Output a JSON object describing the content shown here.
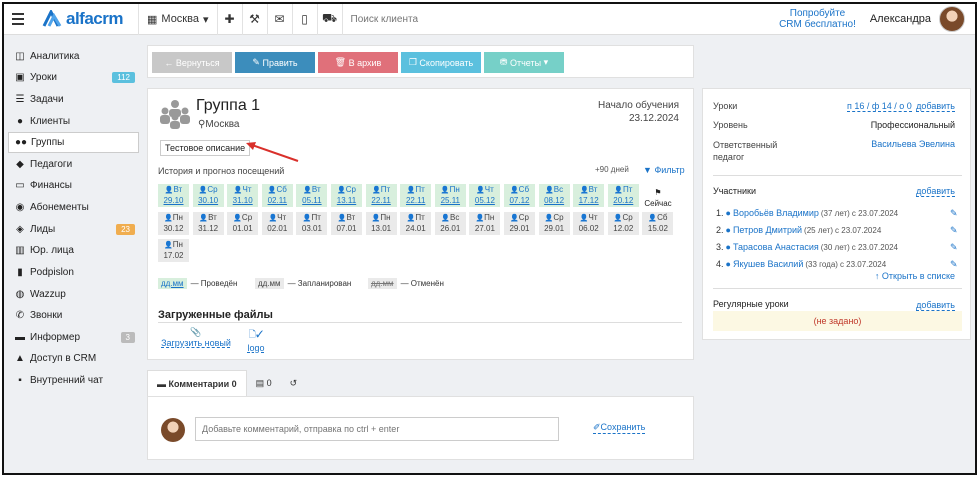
{
  "header": {
    "logo_text": "alfacrm",
    "branch": "Москва",
    "search_placeholder": "Поиск клиента",
    "promo_line1": "Попробуйте",
    "promo_line2": "CRM бесплатно!",
    "user_name": "Александра"
  },
  "sidebar": {
    "items": [
      {
        "label": "Аналитика",
        "icon": "chart-icon"
      },
      {
        "label": "Уроки",
        "icon": "calendar-icon",
        "badge": "112",
        "badge_color": "#5bc0de"
      },
      {
        "label": "Задачи",
        "icon": "tasks-icon"
      },
      {
        "label": "Клиенты",
        "icon": "user-icon"
      },
      {
        "label": "Группы",
        "icon": "group-icon",
        "active": true
      },
      {
        "label": "Педагоги",
        "icon": "graduation-cap-icon"
      },
      {
        "label": "Финансы",
        "icon": "money-icon"
      },
      {
        "label": "Абонементы",
        "icon": "subscription-icon"
      },
      {
        "label": "Лиды",
        "icon": "leads-icon",
        "badge": "23",
        "badge_color": "#f0ad4e"
      },
      {
        "label": "Юр. лица",
        "icon": "building-icon"
      },
      {
        "label": "Podpislon",
        "icon": "document-icon"
      },
      {
        "label": "Wazzup",
        "icon": "whatsapp-icon"
      },
      {
        "label": "Звонки",
        "icon": "phone-icon"
      },
      {
        "label": "Информер",
        "icon": "message-icon",
        "badge": "3",
        "badge_color": "#bbbbbb"
      },
      {
        "label": "Доступ в CRM",
        "icon": "lock-icon"
      },
      {
        "label": "Внутренний чат",
        "icon": "chat-icon"
      }
    ]
  },
  "actions": {
    "back": "← Вернуться",
    "edit": "Править",
    "archive": "В архив",
    "copy": "Скопировать",
    "reports": "Отчеты"
  },
  "group": {
    "title": "Группа 1",
    "city": "Москва",
    "start_label": "Начало обучения",
    "start_date": "23.12.2024",
    "description": "Тестовое описание",
    "history_label": "История и прогноз посещений",
    "days_label": "+90 дней",
    "filter_label": "Фильтр",
    "now_label": "Сейчас"
  },
  "attendance": {
    "done": [
      {
        "wd": "Вт",
        "date": "29.10"
      },
      {
        "wd": "Ср",
        "date": "30.10"
      },
      {
        "wd": "Чт",
        "date": "31.10"
      },
      {
        "wd": "Сб",
        "date": "02.11"
      },
      {
        "wd": "Вт",
        "date": "05.11"
      },
      {
        "wd": "Ср",
        "date": "13.11"
      },
      {
        "wd": "Пт",
        "date": "22.11"
      },
      {
        "wd": "Пт",
        "date": "22.11"
      },
      {
        "wd": "Пн",
        "date": "25.11"
      },
      {
        "wd": "Чт",
        "date": "05.12"
      },
      {
        "wd": "Сб",
        "date": "07.12"
      },
      {
        "wd": "Вс",
        "date": "08.12"
      },
      {
        "wd": "Вт",
        "date": "17.12"
      },
      {
        "wd": "Пт",
        "date": "20.12"
      }
    ],
    "planned": [
      {
        "wd": "Пн",
        "date": "30.12"
      },
      {
        "wd": "Вт",
        "date": "31.12"
      },
      {
        "wd": "Ср",
        "date": "01.01"
      },
      {
        "wd": "Чт",
        "date": "02.01"
      },
      {
        "wd": "Пт",
        "date": "03.01"
      },
      {
        "wd": "Вт",
        "date": "07.01"
      },
      {
        "wd": "Пн",
        "date": "13.01"
      },
      {
        "wd": "Пт",
        "date": "24.01"
      },
      {
        "wd": "Вс",
        "date": "26.01"
      },
      {
        "wd": "Пн",
        "date": "27.01"
      },
      {
        "wd": "Ср",
        "date": "29.01"
      },
      {
        "wd": "Ср",
        "date": "29.01"
      },
      {
        "wd": "Чт",
        "date": "06.02"
      },
      {
        "wd": "Ср",
        "date": "12.02"
      },
      {
        "wd": "Сб",
        "date": "15.02"
      },
      {
        "wd": "Пн",
        "date": "17.02"
      }
    ]
  },
  "legend": {
    "sample": "дд.мм",
    "done": "— Проведён",
    "planned": "— Запланирован",
    "cancelled": "— Отменён"
  },
  "files": {
    "title": "Загруженные файлы",
    "upload": "Загрузить новый",
    "file_name": "logo"
  },
  "tabs": {
    "comments": "Комментарии 0",
    "docs_count": "0"
  },
  "comment": {
    "placeholder": "Добавьте комментарий, отправка по ctrl + enter",
    "save": "Сохранить"
  },
  "info": {
    "lessons_label": "Уроки",
    "lessons_value": "п 16 / ф 14 / о 0",
    "add": "добавить",
    "level_label": "Уровень",
    "level_value": "Профессиональный",
    "teacher_label_1": "Ответственный",
    "teacher_label_2": "педагог",
    "teacher_value": "Васильева Эвелина",
    "members_label": "Участники",
    "members": [
      {
        "n": "1.",
        "name": "Воробьёв Владимир",
        "age": "(37 лет)",
        "since": "с 23.07.2024"
      },
      {
        "n": "2.",
        "name": "Петров Дмитрий",
        "age": "(25 лет)",
        "since": "с 23.07.2024"
      },
      {
        "n": "3.",
        "name": "Тарасова Анастасия",
        "age": "(30 лет)",
        "since": "с 23.07.2024"
      },
      {
        "n": "4.",
        "name": "Якушев Василий",
        "age": "(33 года)",
        "since": "с 23.07.2024"
      }
    ],
    "open_list": "Открыть в списке",
    "regular_label": "Регулярные уроки",
    "not_set": "(не задано)"
  }
}
